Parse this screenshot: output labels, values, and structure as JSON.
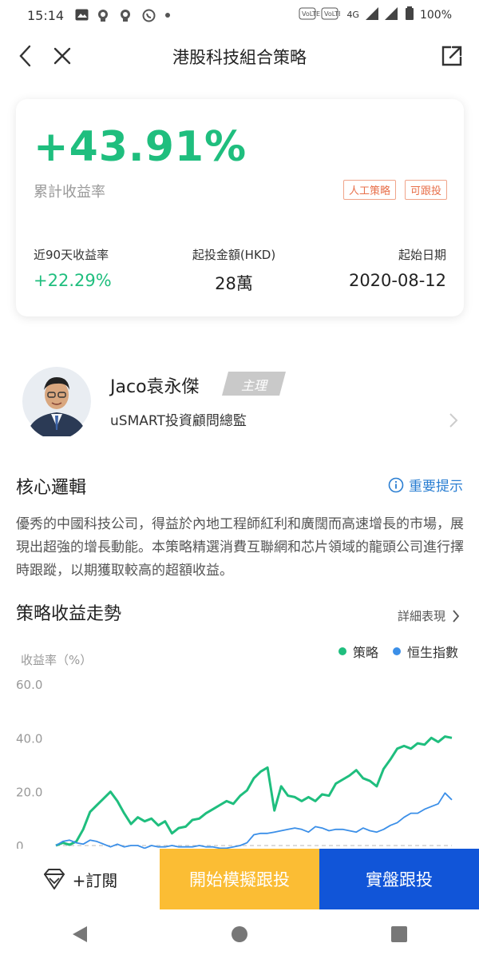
{
  "status_bar": {
    "time": "15:14",
    "battery": "100%",
    "network": "4G"
  },
  "header": {
    "title": "港股科技組合策略"
  },
  "summary": {
    "cumulative_return": "+43.91%",
    "cumulative_label": "累計收益率",
    "tags": [
      "人工策略",
      "可跟投"
    ],
    "stats": [
      {
        "label": "近90天收益率",
        "value": "+22.29%"
      },
      {
        "label": "起投金額(HKD)",
        "value": "28萬"
      },
      {
        "label": "起始日期",
        "value": "2020-08-12"
      }
    ]
  },
  "advisor": {
    "name": "Jaco袁永傑",
    "badge": "主理",
    "title": "uSMART投資顧問總監"
  },
  "logic": {
    "title": "核心邏輯",
    "notice": "重要提示",
    "description": "優秀的中國科技公司，得益於內地工程師紅利和廣闊而高速增長的市場，展現出超強的增長動能。本策略精選消費互聯網和芯片領域的龍頭公司進行擇時跟蹤，以期獲取較高的超額收益。"
  },
  "trend": {
    "title": "策略收益走勢",
    "detail_link": "詳細表現"
  },
  "chart_data": {
    "type": "line",
    "ylabel": "收益率（%）",
    "yticks": [
      "60.0",
      "40.0",
      "20.0",
      "0"
    ],
    "ylim": [
      0,
      60
    ],
    "legend_position": "top-right",
    "series": [
      {
        "name": "策略",
        "color": "#1fbe7e",
        "values": [
          0.0,
          1.0,
          0.3,
          1.5,
          6.0,
          12.5,
          15.0,
          17.5,
          20.0,
          16.5,
          12.0,
          8.0,
          10.5,
          9.0,
          10.0,
          7.5,
          9.0,
          4.5,
          6.5,
          7.0,
          9.5,
          10.0,
          12.0,
          13.5,
          15.0,
          16.5,
          15.5,
          18.5,
          20.5,
          25.0,
          27.5,
          29.0,
          13.0,
          22.0,
          18.5,
          18.0,
          16.5,
          18.0,
          16.5,
          19.0,
          18.5,
          23.0,
          24.5,
          26.0,
          28.0,
          25.0,
          24.0,
          22.0,
          28.5,
          32.0,
          36.0,
          37.0,
          36.0,
          38.0,
          37.5,
          40.0,
          38.5,
          40.5,
          40.0
        ]
      },
      {
        "name": "恒生指數",
        "color": "#3b8fe8",
        "values": [
          0.0,
          1.5,
          2.0,
          1.0,
          0.5,
          2.0,
          1.5,
          0.5,
          -0.5,
          0.5,
          -0.5,
          0.0,
          0.0,
          -1.0,
          0.0,
          -0.5,
          -0.5,
          0.0,
          -0.5,
          -0.5,
          -0.5,
          0.0,
          -0.5,
          -0.5,
          -1.0,
          -1.0,
          -0.5,
          0.0,
          1.0,
          4.0,
          4.5,
          4.5,
          5.0,
          5.5,
          6.0,
          6.5,
          6.0,
          5.0,
          7.0,
          6.5,
          5.5,
          6.0,
          6.0,
          5.5,
          5.0,
          6.5,
          5.5,
          5.0,
          6.0,
          7.5,
          8.5,
          10.5,
          12.0,
          12.0,
          13.5,
          14.5,
          15.5,
          19.5,
          17.0
        ]
      }
    ]
  },
  "bottom_bar": {
    "subscribe": "+訂閱",
    "simulate": "開始模擬跟投",
    "real": "實盤跟投"
  }
}
